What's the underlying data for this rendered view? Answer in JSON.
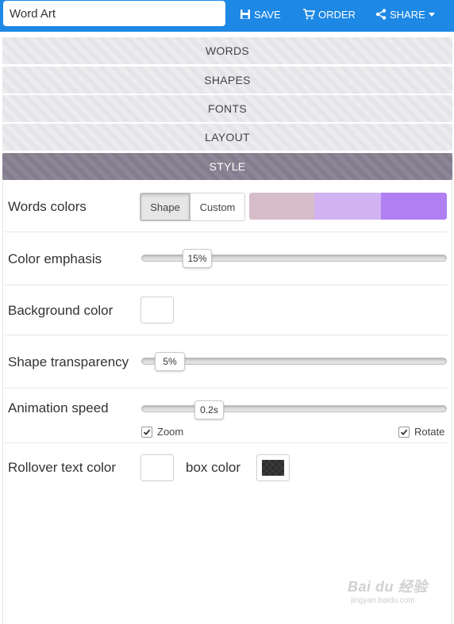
{
  "header": {
    "title_value": "Word Art",
    "save_label": "SAVE",
    "order_label": "ORDER",
    "share_label": "SHARE"
  },
  "accordion": {
    "words": "WORDS",
    "shapes": "SHAPES",
    "fonts": "FONTS",
    "layout": "LAYOUT",
    "style": "STYLE"
  },
  "style_panel": {
    "words_colors": {
      "label": "Words colors",
      "options": [
        "Shape",
        "Custom"
      ],
      "selected": "Shape",
      "swatches": [
        "#d7bcc9",
        "#d1b2f3",
        "#b07ff2"
      ]
    },
    "color_emphasis": {
      "label": "Color emphasis",
      "value_text": "15%",
      "level": 0.15
    },
    "background_color": {
      "label": "Background color",
      "color": "#ffffff"
    },
    "shape_transparency": {
      "label": "Shape transparency",
      "value_text": "5%",
      "level": 0.05
    },
    "animation_speed": {
      "label": "Animation speed",
      "value_text": "0.2s",
      "level": 0.2
    },
    "zoom": {
      "label": "Zoom",
      "checked": true
    },
    "rotate": {
      "label": "Rotate",
      "checked": true
    },
    "rollover": {
      "label": "Rollover text color",
      "text_color": "#ffffff",
      "box_label": "box color",
      "box_color": "#333333"
    }
  },
  "watermark": {
    "brand": "Bai du 经验",
    "url": "jingyan.baidu.com"
  },
  "colors": {
    "header_blue": "#1e88e5",
    "accordion_gray": "#e5e4e8",
    "accordion_active": "#837d8e"
  }
}
